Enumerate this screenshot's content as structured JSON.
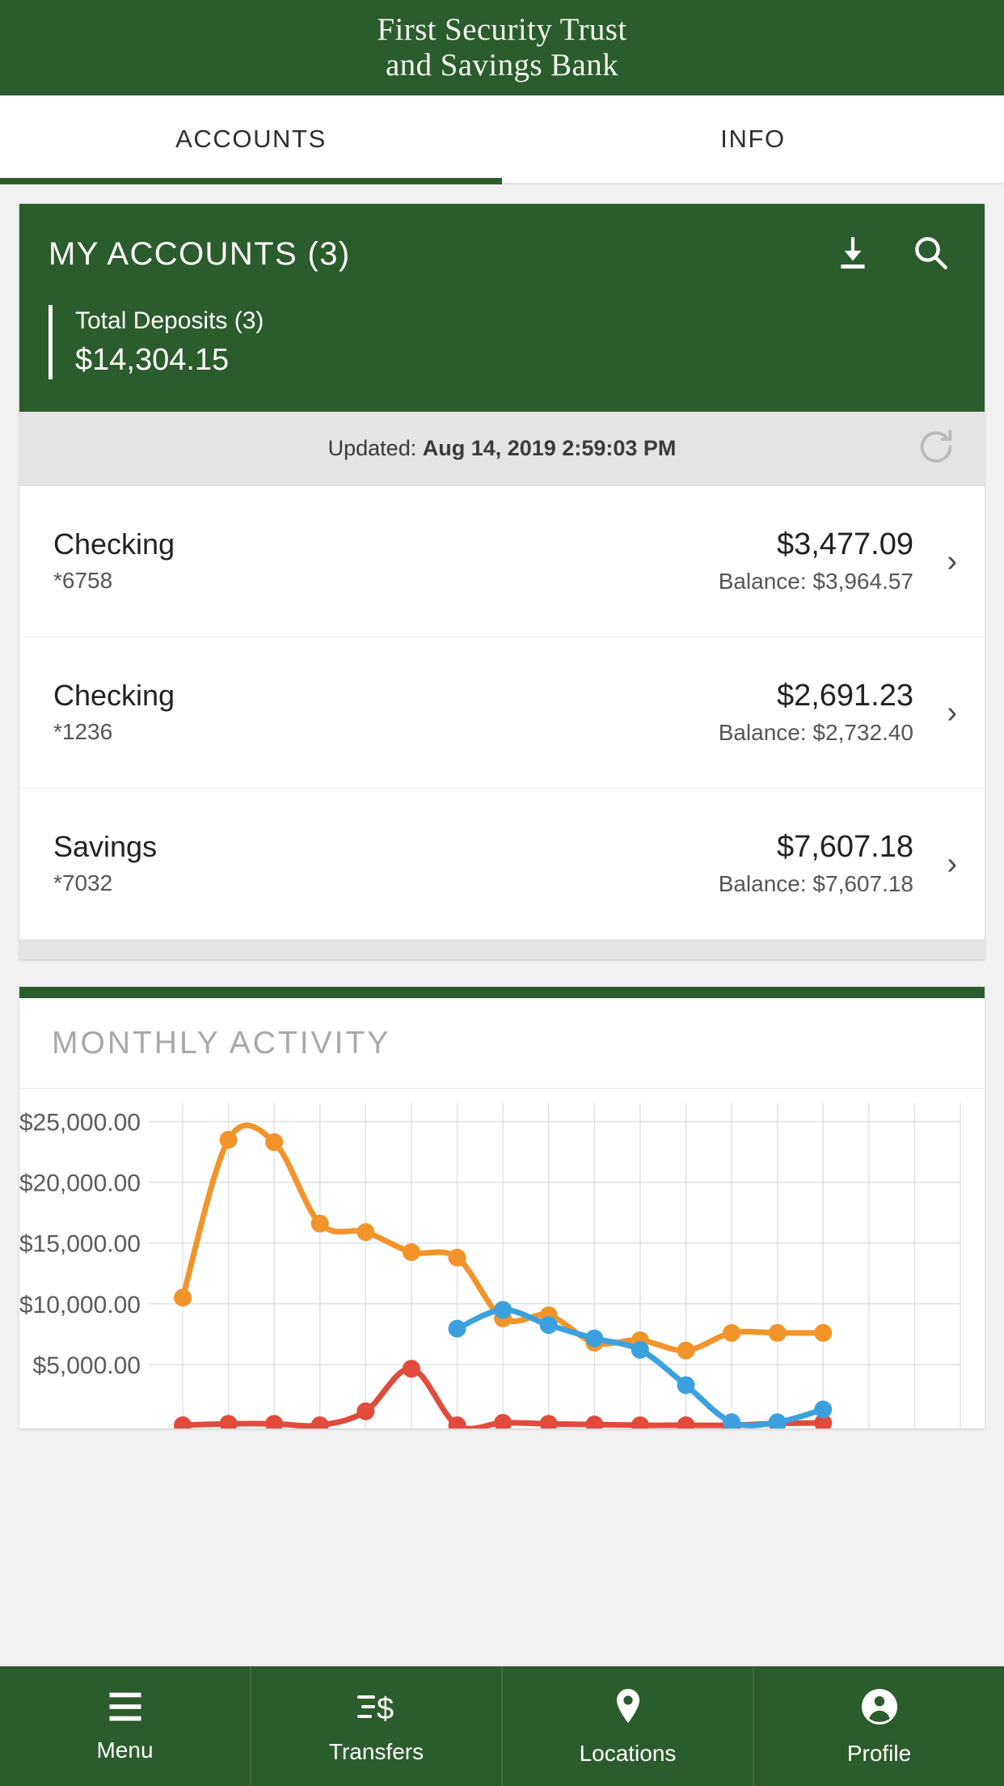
{
  "brand": {
    "title": "First Security Trust\nand Savings Bank"
  },
  "tabs": [
    {
      "label": "ACCOUNTS",
      "active": true
    },
    {
      "label": "INFO",
      "active": false
    }
  ],
  "accounts_card": {
    "title": "MY ACCOUNTS (3)",
    "download_icon": "download-icon",
    "search_icon": "search-icon",
    "total_label": "Total Deposits (3)",
    "total_amount": "$14,304.15",
    "updated_prefix": "Updated: ",
    "updated_value": "Aug 14, 2019 2:59:03 PM",
    "refresh_icon": "refresh-icon",
    "rows": [
      {
        "name": "Checking",
        "number": "*6758",
        "amount": "$3,477.09",
        "balance": "Balance: $3,964.57",
        "chevron": "›"
      },
      {
        "name": "Checking",
        "number": "*1236",
        "amount": "$2,691.23",
        "balance": "Balance: $2,732.40",
        "chevron": "›"
      },
      {
        "name": "Savings",
        "number": "*7032",
        "amount": "$7,607.18",
        "balance": "Balance: $7,607.18",
        "chevron": "›"
      }
    ]
  },
  "monthly_activity": {
    "title": "MONTHLY ACTIVITY"
  },
  "chart_data": {
    "type": "line",
    "title": "MONTHLY ACTIVITY",
    "xlabel": "",
    "ylabel": "",
    "ylim": [
      0,
      26500
    ],
    "grid": true,
    "legend": "none",
    "ytick_labels": [
      "$25,000.00",
      "$20,000.00",
      "$15,000.00",
      "$10,000.00",
      "$5,000.00"
    ],
    "ytick_values": [
      25000,
      20000,
      15000,
      10000,
      5000
    ],
    "x": [
      1,
      2,
      3,
      4,
      5,
      6,
      7,
      8,
      9,
      10,
      11,
      12,
      13,
      14,
      15,
      16,
      17,
      18
    ],
    "series": [
      {
        "name": "Checking *6758",
        "color": "#F2942A",
        "values": [
          10500,
          23500,
          23300,
          16600,
          15900,
          14250,
          13800,
          8800,
          9050,
          6800,
          7000,
          6150,
          7600,
          7600,
          7600,
          null,
          null,
          null
        ]
      },
      {
        "name": "Checking *1236",
        "color": "#3BA1DE",
        "values": [
          null,
          null,
          null,
          null,
          null,
          null,
          7950,
          9500,
          8250,
          7150,
          6200,
          3300,
          250,
          250,
          1300,
          null,
          null,
          null
        ]
      },
      {
        "name": "Savings *7032",
        "color": "#E14B3C",
        "values": [
          0,
          120,
          120,
          0,
          1150,
          4650,
          0,
          200,
          120,
          60,
          0,
          0,
          0,
          150,
          200,
          null,
          null,
          null
        ]
      }
    ]
  },
  "bottom_nav": [
    {
      "label": "Menu",
      "icon": "hamburger-menu-icon"
    },
    {
      "label": "Transfers",
      "icon": "transfers-dollar-icon"
    },
    {
      "label": "Locations",
      "icon": "map-pin-icon"
    },
    {
      "label": "Profile",
      "icon": "person-icon"
    }
  ],
  "colors": {
    "brand_green": "#2b5c2b",
    "orange": "#F2942A",
    "blue": "#3BA1DE",
    "red": "#E14B3C"
  }
}
